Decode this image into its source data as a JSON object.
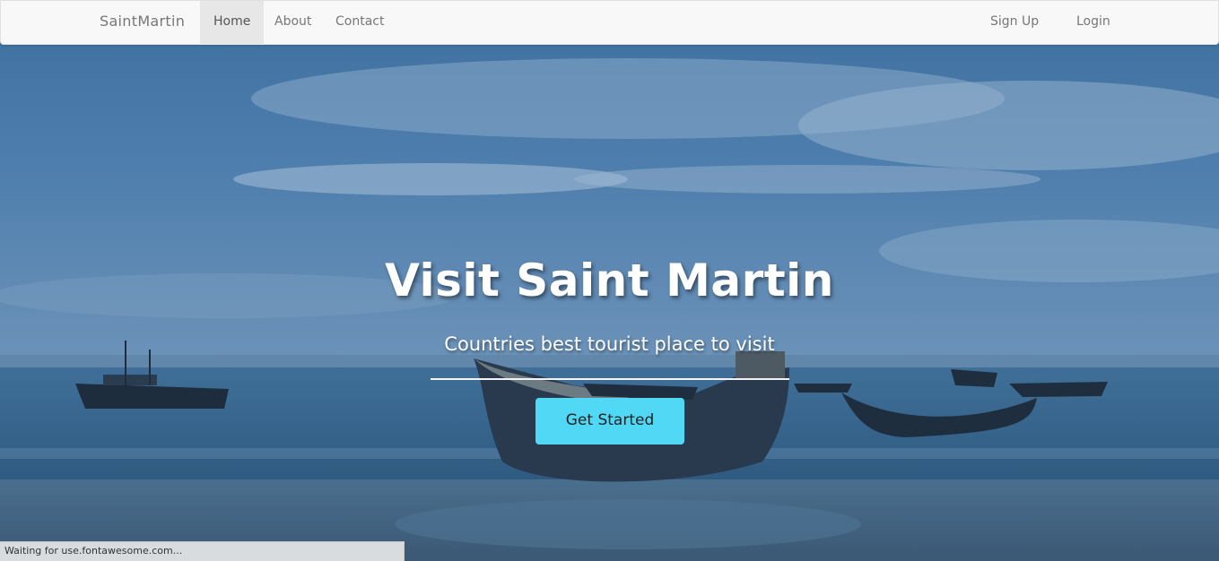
{
  "navbar": {
    "brand": "SaintMartin",
    "links": [
      {
        "label": "Home",
        "active": true
      },
      {
        "label": "About",
        "active": false
      },
      {
        "label": "Contact",
        "active": false
      }
    ],
    "right_links": [
      {
        "label": "Sign Up"
      },
      {
        "label": "Login"
      }
    ]
  },
  "hero": {
    "title": "Visit Saint Martin",
    "subtitle": "Countries best tourist place to visit",
    "cta_label": "Get Started"
  },
  "status_bar": {
    "text": "Waiting for use.fontawesome.com..."
  },
  "colors": {
    "cta": "#50d8f5",
    "navbar_bg": "#f8f8f8",
    "nav_text": "#777777"
  }
}
